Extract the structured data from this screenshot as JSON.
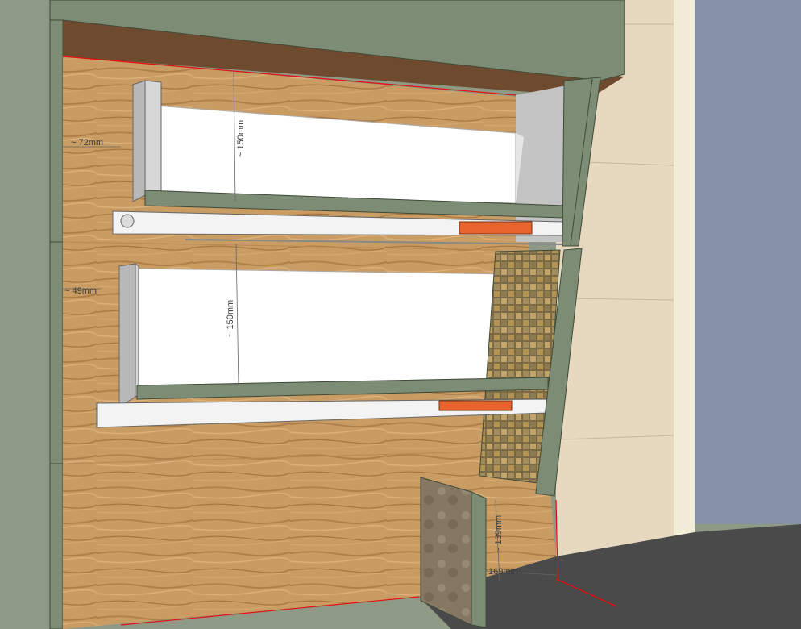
{
  "viewport": {
    "colors": {
      "cabinet_green": "#7d8c74",
      "green_dark": "#4c5a45",
      "wood": "#c79a62",
      "wood_dark": "#a9773f",
      "drawer_white": "#ffffff",
      "drawer_grey": "#cfcfcf",
      "beige_wall": "#e7d9bf",
      "blue_wall": "#8591a8",
      "floor": "#4a4a4a",
      "ceiling_brown": "#6e4a2f",
      "runner_orange": "#e8642d",
      "red_axis": "#e01010"
    }
  },
  "dimensions": {
    "upper_left_gap": "~ 72mm",
    "upper_drawer_height": "~ 150mm",
    "lower_left_gap": "~ 49mm",
    "lower_drawer_height": "~ 150mm",
    "toe_kick_height": "~ 139mm",
    "toe_kick_depth": "169mm"
  }
}
